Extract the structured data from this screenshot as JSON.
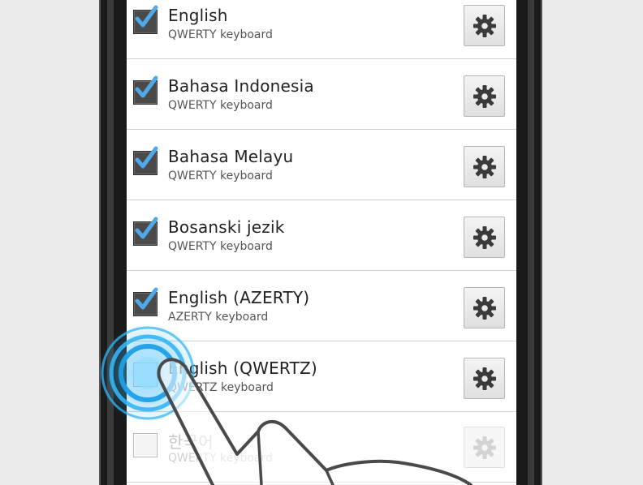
{
  "keyboard_list": {
    "items": [
      {
        "title": "English",
        "subtitle": "QWERTY keyboard",
        "checked": true
      },
      {
        "title": "Bahasa Indonesia",
        "subtitle": "QWERTY keyboard",
        "checked": true
      },
      {
        "title": "Bahasa Melayu",
        "subtitle": "QWERTY keyboard",
        "checked": true
      },
      {
        "title": "Bosanski jezik",
        "subtitle": "QWERTY keyboard",
        "checked": true
      },
      {
        "title": "English (AZERTY)",
        "subtitle": "AZERTY keyboard",
        "checked": true
      },
      {
        "title": "English (QWERTZ)",
        "subtitle": "QWERTZ keyboard",
        "checked": false
      },
      {
        "title": "한국어",
        "subtitle": "QWERTY keyboard",
        "checked": false,
        "disabled": true
      }
    ]
  },
  "icons": {
    "checkbox_checked": "check-icon",
    "settings": "gear-icon",
    "touch": "tap-indicator-icon",
    "hand": "hand-pointer-icon"
  },
  "colors": {
    "checkmark": "#4fa8e8",
    "checkbox_fill": "#4a4a4a",
    "tap_ripple": "#33b5f5",
    "gear": "#3a3a3a"
  }
}
